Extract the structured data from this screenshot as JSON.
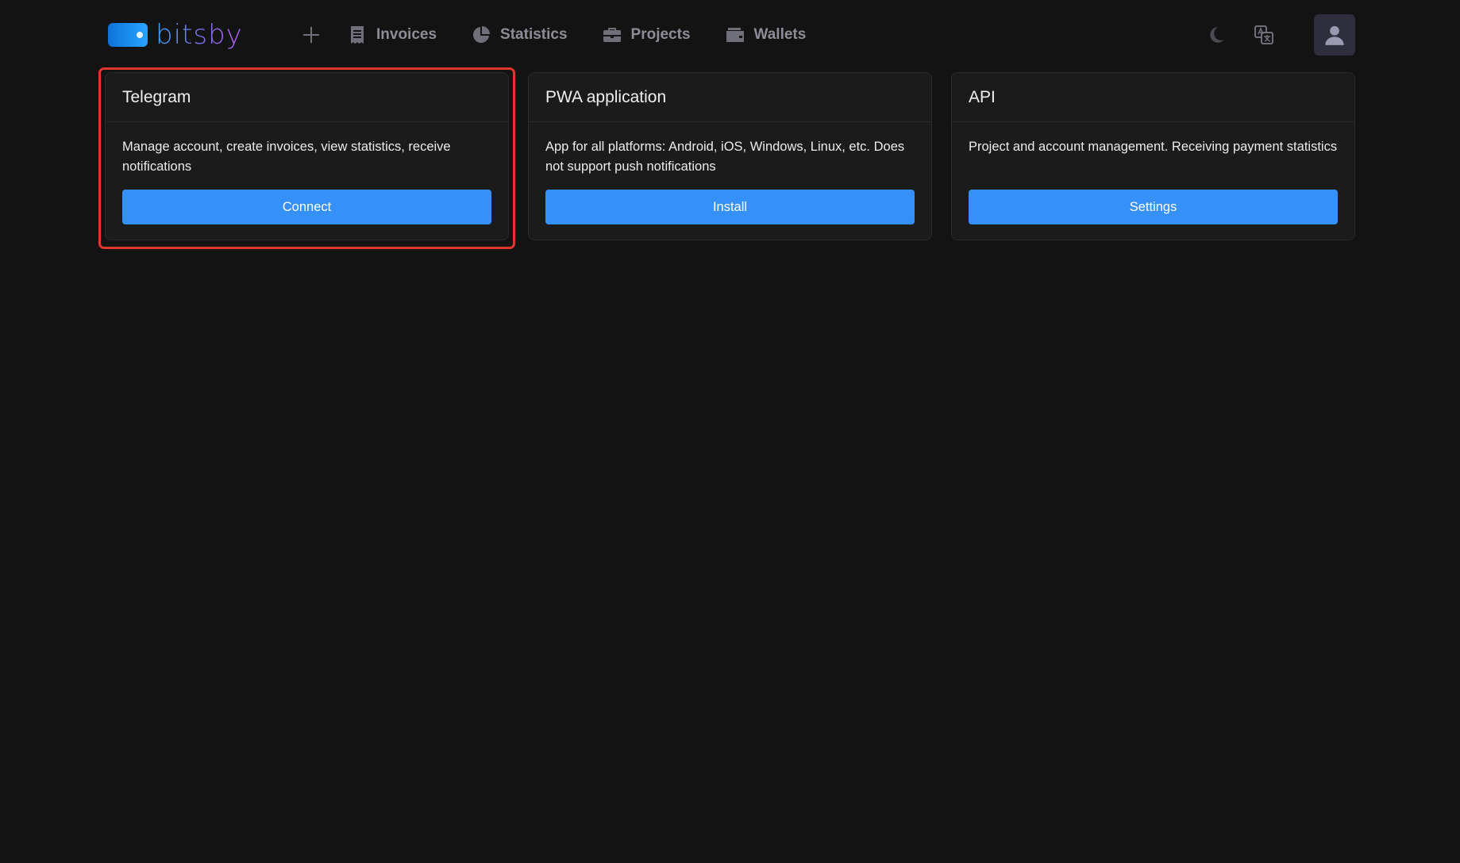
{
  "app": {
    "brand": "bitsby"
  },
  "nav": {
    "items": [
      {
        "label": "Invoices",
        "icon": "receipt-icon"
      },
      {
        "label": "Statistics",
        "icon": "pie-chart-icon"
      },
      {
        "label": "Projects",
        "icon": "briefcase-icon"
      },
      {
        "label": "Wallets",
        "icon": "wallet-icon"
      }
    ]
  },
  "tools": {
    "theme_icon": "moon-icon",
    "language_icon": "translate-icon",
    "avatar_icon": "user-icon"
  },
  "cards": [
    {
      "title": "Telegram",
      "description": "Manage account, create invoices, view statistics, receive notifications",
      "button": "Connect"
    },
    {
      "title": "PWA application",
      "description": "App for all platforms: Android, iOS, Windows, Linux, etc. Does not support push notifications",
      "button": "Install"
    },
    {
      "title": "API",
      "description": "Project and account management. Receiving payment statistics",
      "button": "Settings"
    }
  ],
  "colors": {
    "background": "#131313",
    "card_background": "#1b1b1b",
    "accent": "#3590f7",
    "highlight": "#e0372c"
  }
}
